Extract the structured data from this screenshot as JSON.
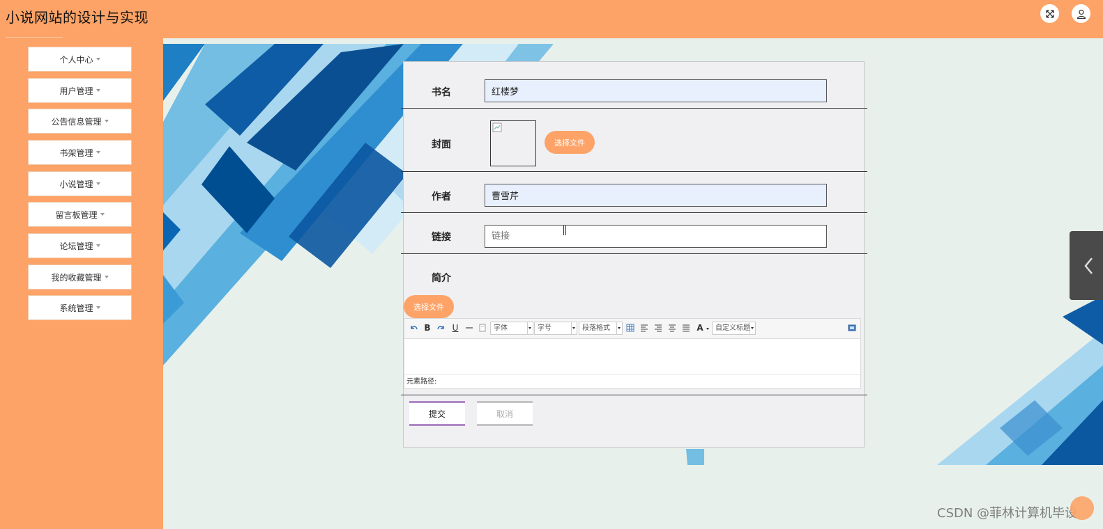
{
  "app": {
    "title": "小说网站的设计与实现"
  },
  "header": {
    "fullscreen_icon": "fullscreen-icon",
    "user_icon": "user-icon"
  },
  "sidebar": {
    "items": [
      {
        "label": "个人中心"
      },
      {
        "label": "用户管理"
      },
      {
        "label": "公告信息管理"
      },
      {
        "label": "书架管理"
      },
      {
        "label": "小说管理"
      },
      {
        "label": "留言板管理"
      },
      {
        "label": "论坛管理"
      },
      {
        "label": "我的收藏管理"
      },
      {
        "label": "系统管理"
      }
    ]
  },
  "form": {
    "book_name": {
      "label": "书名",
      "value": "红楼梦"
    },
    "cover": {
      "label": "封面",
      "choose_file_label": "选择文件"
    },
    "author": {
      "label": "作者",
      "value": "曹雪芹"
    },
    "link": {
      "label": "链接",
      "value": "",
      "placeholder": "链接"
    },
    "intro": {
      "label": "简介",
      "choose_file_label": "选择文件"
    }
  },
  "editor": {
    "font_family": "字体",
    "font_size": "字号",
    "paragraph_format": "段落格式",
    "custom_title": "自定义标题",
    "bold_glyph": "B",
    "underline_glyph": "U",
    "font_color_glyph": "A",
    "element_path": "元素路径:"
  },
  "actions": {
    "submit_label": "提交",
    "cancel_label": "取消"
  },
  "watermark": "CSDN @菲林计算机毕设",
  "colors": {
    "accent": "#fda367",
    "input_fill": "#e8f0fe",
    "submit_border": "#b089c8",
    "cancel_border": "#c4c4c4"
  }
}
